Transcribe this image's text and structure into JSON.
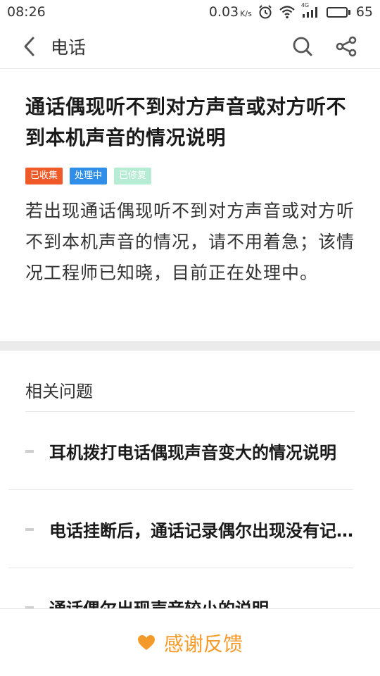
{
  "status_bar": {
    "time": "08:26",
    "speed": "0.03",
    "speed_unit": "K/s",
    "signal_label": "4G",
    "battery": "65",
    "battery_level": 0.65
  },
  "header": {
    "title": "电话",
    "icons": {
      "back": "chevron-left-icon",
      "search": "search-icon",
      "share": "share-icon"
    }
  },
  "article": {
    "title": "通话偶现听不到对方声音或对方听不到本机声音的情况说明",
    "tags": [
      {
        "label": "已收集",
        "color": "#f05a28"
      },
      {
        "label": "处理中",
        "color": "#2f8fe8"
      },
      {
        "label": "已修复",
        "color": "#b6ecd3"
      }
    ],
    "body": "若出现通话偶现听不到对方声音或对方听不到本机声音的情况，请不用着急；该情况工程师已知晓，目前正在处理中。"
  },
  "related": {
    "title": "相关问题",
    "items": [
      "耳机拨打电话偶现声音变大的情况说明",
      "电话挂断后，通话记录偶尔出现没有记录的情况说明",
      "通话偶尔出现声音较小的说明"
    ]
  },
  "footer": {
    "label": "感谢反馈",
    "icon": "heart-icon",
    "color": "#f39a2a"
  }
}
